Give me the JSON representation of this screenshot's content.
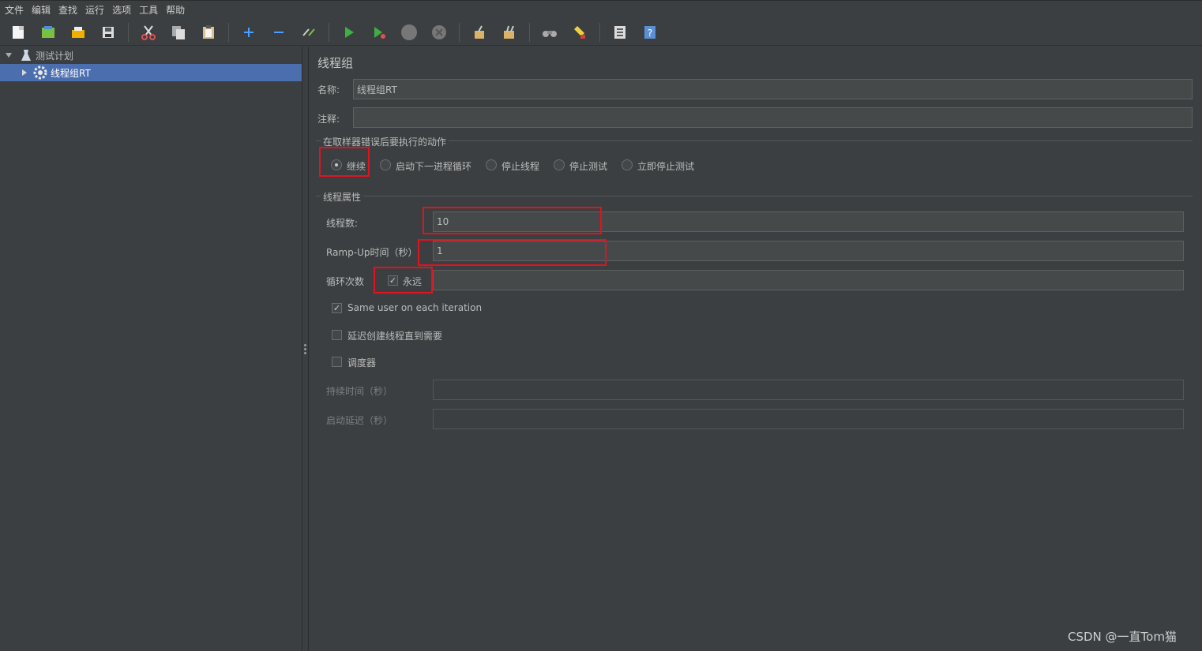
{
  "menu": [
    "文件",
    "编辑",
    "查找",
    "运行",
    "选项",
    "工具",
    "帮助"
  ],
  "toolbar": [
    {
      "name": "new-icon",
      "color": "#f5f5f5"
    },
    {
      "name": "templates-icon",
      "color": "#7bc043"
    },
    {
      "name": "open-icon",
      "color": "#f0b000"
    },
    {
      "name": "save-icon",
      "color": "#dcdcdc"
    },
    {
      "name": "cut-icon",
      "color": "#e05050"
    },
    {
      "name": "copy-icon",
      "color": "#dcdcdc"
    },
    {
      "name": "paste-icon",
      "color": "#d8c090"
    },
    {
      "name": "expand-icon",
      "color": "#4a9fff"
    },
    {
      "name": "collapse-icon",
      "color": "#4a9fff"
    },
    {
      "name": "toggle-icon",
      "color": "#cccccc"
    },
    {
      "name": "start-icon",
      "color": "#3cb043"
    },
    {
      "name": "start-no-pause-icon",
      "color": "#3cb043"
    },
    {
      "name": "stop-icon",
      "color": "#777777"
    },
    {
      "name": "shutdown-icon",
      "color": "#777777"
    },
    {
      "name": "clear-icon",
      "color": "#d9b36a"
    },
    {
      "name": "clear-all-icon",
      "color": "#d9b36a"
    },
    {
      "name": "search-icon",
      "color": "#cccccc"
    },
    {
      "name": "reset-search-icon",
      "color": "#f0d040"
    },
    {
      "name": "function-helper-icon",
      "color": "#dcdcdc"
    },
    {
      "name": "help-icon",
      "color": "#5b8fd6"
    }
  ],
  "tree": {
    "root": "测试计划",
    "child": "线程组RT"
  },
  "panel": {
    "title": "线程组",
    "name_label": "名称:",
    "name_value": "线程组RT",
    "comment_label": "注释:",
    "comment_value": "",
    "error_section": "在取样器错误后要执行的动作",
    "error_options": [
      "继续",
      "启动下一进程循环",
      "停止线程",
      "停止测试",
      "立即停止测试"
    ],
    "error_selected": "继续",
    "props_section": "线程属性",
    "threads_label": "线程数:",
    "threads_value": "10",
    "rampup_label": "Ramp-Up时间（秒）",
    "rampup_value": "1",
    "loop_label": "循环次数",
    "loop_forever_label": "永远",
    "loop_forever_checked": true,
    "same_user_label": "Same user on each iteration",
    "same_user_checked": true,
    "delay_label": "延迟创建线程直到需要",
    "delay_checked": false,
    "scheduler_label": "调度器",
    "scheduler_checked": false,
    "duration_label": "持续时间（秒）",
    "duration_value": "",
    "startup_label": "启动延迟（秒）",
    "startup_value": ""
  },
  "watermark": "CSDN @一直Tom猫",
  "colors": {
    "highlight": "#e0131f",
    "selected": "#4b6eaf",
    "background": "#3c3f41"
  }
}
